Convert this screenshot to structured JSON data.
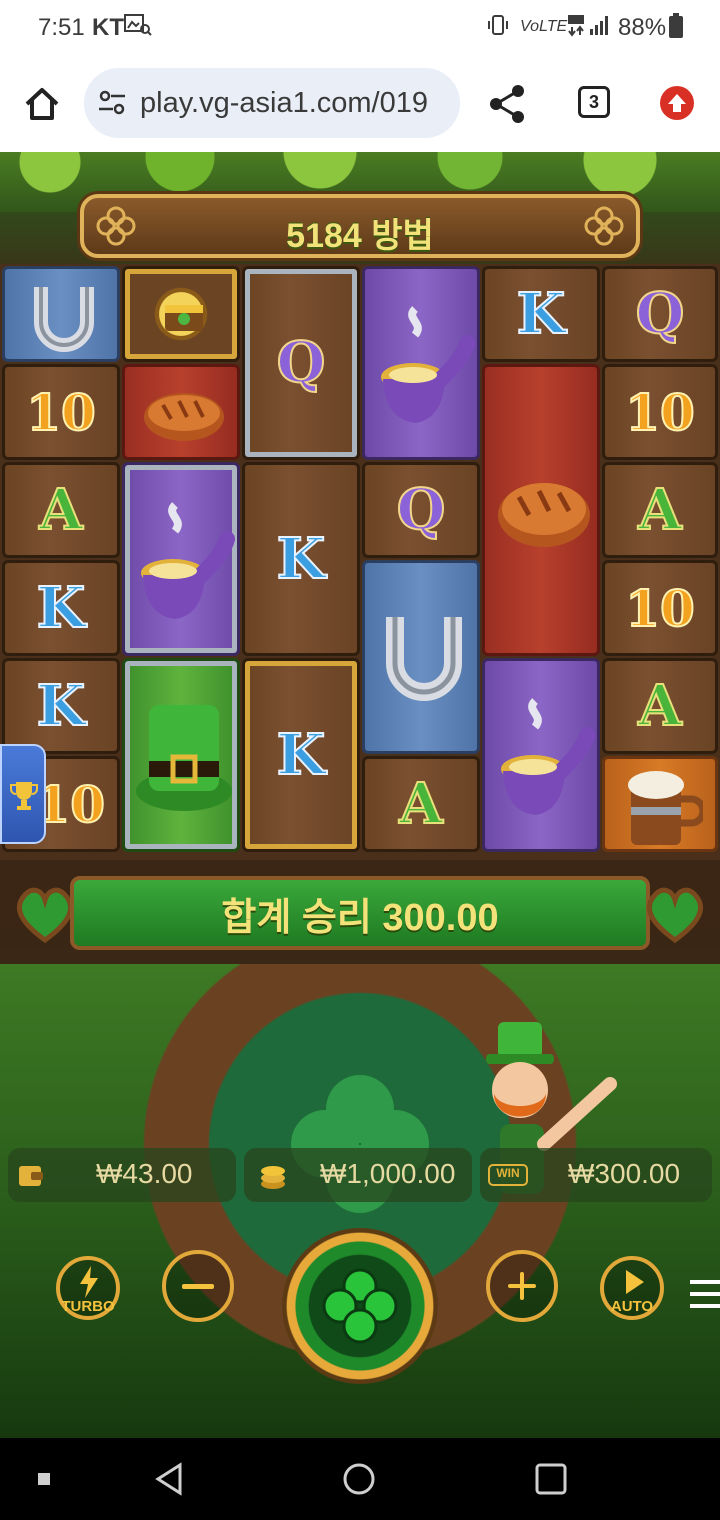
{
  "status_bar": {
    "time": "7:51",
    "carrier": "KT",
    "battery": "88%"
  },
  "browser": {
    "url": "play.vg-asia1.com/019",
    "tab_count": "3"
  },
  "game": {
    "ways_label": "5184 방법",
    "total_win_label": "합계 승리 300.00",
    "balance": "₩43.00",
    "bet": "₩1,000.00",
    "win": "₩300.00",
    "buttons": {
      "turbo": "TURBO",
      "auto": "AUTO"
    },
    "win_badge": "WIN",
    "symbols": {
      "q": "Q",
      "k": "K",
      "a": "A",
      "ten": "10"
    }
  }
}
